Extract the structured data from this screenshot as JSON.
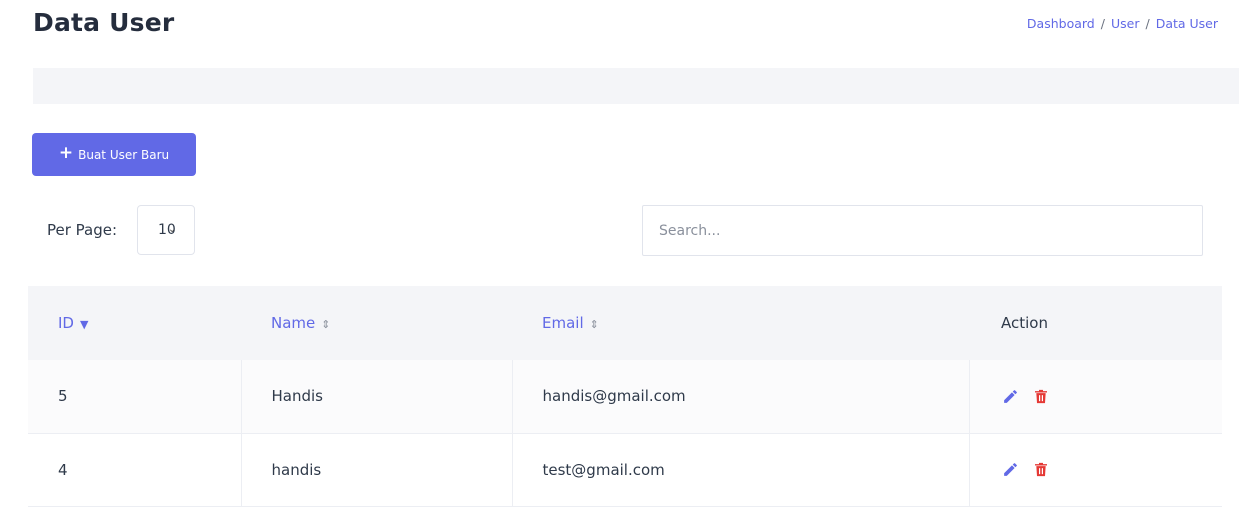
{
  "header": {
    "title": "Data User",
    "breadcrumb": [
      "Dashboard",
      "User",
      "Data User"
    ],
    "separator": "/"
  },
  "toolbar": {
    "add_icon": "plus-icon",
    "add_label": "Buat User Baru",
    "per_page_label": "Per Page:",
    "per_page_value": "10",
    "search_placeholder": "Search..."
  },
  "table": {
    "columns": [
      {
        "label": "ID",
        "sort": "desc"
      },
      {
        "label": "Name",
        "sort": "sortable"
      },
      {
        "label": "Email",
        "sort": "sortable"
      },
      {
        "label": "Action",
        "sort": "none"
      }
    ],
    "rows": [
      {
        "id": "5",
        "name": "Handis",
        "email": "handis@gmail.com"
      },
      {
        "id": "4",
        "name": "handis",
        "email": "test@gmail.com"
      }
    ],
    "action_icons": [
      "edit-icon",
      "delete-icon"
    ]
  },
  "colors": {
    "accent": "#6169e6",
    "danger": "#e53935",
    "header_bg": "#f4f5f8"
  }
}
